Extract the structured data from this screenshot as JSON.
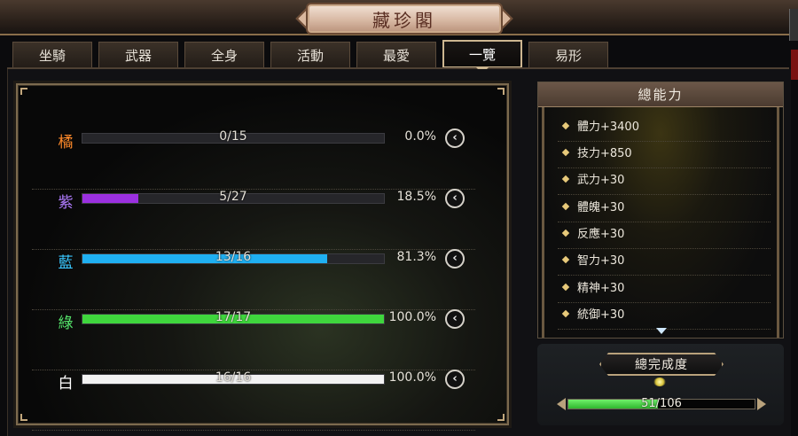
{
  "window": {
    "title": "藏珍閣"
  },
  "tabs": [
    {
      "label": "坐騎"
    },
    {
      "label": "武器"
    },
    {
      "label": "全身"
    },
    {
      "label": "活動"
    },
    {
      "label": "最愛"
    },
    {
      "label": "一覽",
      "active": true
    },
    {
      "label": "易形"
    }
  ],
  "collection": [
    {
      "grade": "橘",
      "color": "#ff8a2a",
      "current": 0,
      "total": 15,
      "progress_text": "0/15",
      "percent_text": "0.0%",
      "fraction": 0.0,
      "bar_color": "#9b9b9b"
    },
    {
      "grade": "紫",
      "color": "#b07cff",
      "current": 5,
      "total": 27,
      "progress_text": "5/27",
      "percent_text": "18.5%",
      "fraction": 0.185,
      "bar_color": "#9b30e0"
    },
    {
      "grade": "藍",
      "color": "#39c7ff",
      "current": 13,
      "total": 16,
      "progress_text": "13/16",
      "percent_text": "81.3%",
      "fraction": 0.813,
      "bar_color": "#1fb0f2"
    },
    {
      "grade": "綠",
      "color": "#55e36a",
      "current": 17,
      "total": 17,
      "progress_text": "17/17",
      "percent_text": "100.0%",
      "fraction": 1.0,
      "bar_color": "#3fd63d"
    },
    {
      "grade": "白",
      "color": "#ffffff",
      "current": 16,
      "total": 16,
      "progress_text": "16/16",
      "percent_text": "100.0%",
      "fraction": 1.0,
      "bar_color": "#f2f2f2"
    }
  ],
  "detail_button_icon": "chevron-left-icon",
  "total_ability": {
    "title": "總能力",
    "stats": [
      "體力+3400",
      "技力+850",
      "武力+30",
      "體魄+30",
      "反應+30",
      "智力+30",
      "精神+30",
      "統御+30"
    ]
  },
  "completion": {
    "title": "總完成度",
    "current": 51,
    "total": 106,
    "progress_text": "51/106",
    "fraction": 0.481
  },
  "colors": {
    "accent_gold": "#cdb690",
    "panel_border": "#7c6a4e"
  }
}
